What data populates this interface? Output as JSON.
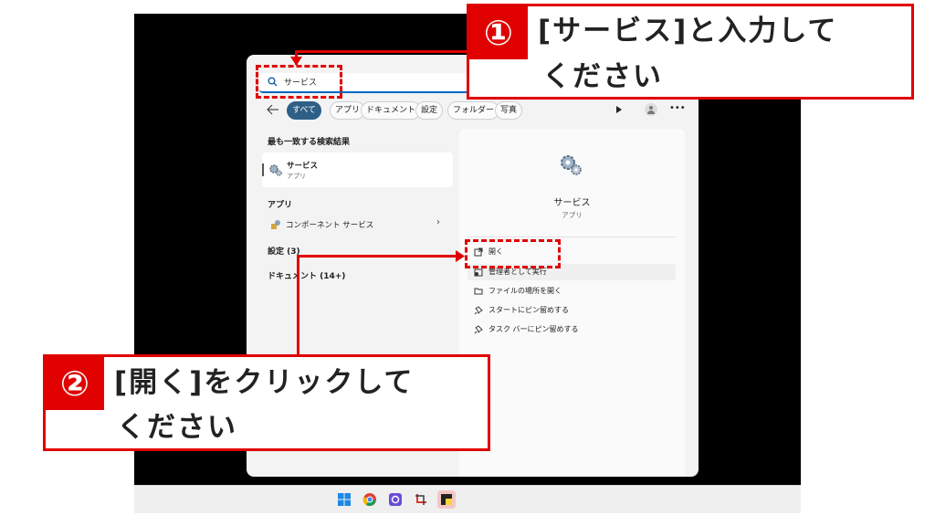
{
  "search": {
    "query": "サービス"
  },
  "tabs": [
    {
      "label": "すべて",
      "active": true
    },
    {
      "label": "アプリ"
    },
    {
      "label": "ドキュメント"
    },
    {
      "label": "設定"
    },
    {
      "label": "フォルダー"
    },
    {
      "label": "写真"
    }
  ],
  "results": {
    "best_match_heading": "最も一致する検索結果",
    "best_match": {
      "title": "サービス",
      "subtitle": "アプリ"
    },
    "apps_heading": "アプリ",
    "app_item": "コンポーネント サービス",
    "settings_heading": "設定 (3)",
    "documents_heading": "ドキュメント (14+)"
  },
  "detail": {
    "title": "サービス",
    "subtitle": "アプリ",
    "actions": [
      {
        "label": "開く",
        "icon": "open-icon"
      },
      {
        "label": "管理者として実行",
        "icon": "admin-shield-icon"
      },
      {
        "label": "ファイルの場所を開く",
        "icon": "folder-icon"
      },
      {
        "label": "スタートにピン留めする",
        "icon": "pin-icon"
      },
      {
        "label": "タスク バーにピン留めする",
        "icon": "pin-icon"
      }
    ]
  },
  "callouts": {
    "step1": {
      "number": "①",
      "line1": "[サービス]と入力して",
      "line2": "ください"
    },
    "step2": {
      "number": "②",
      "line1": "[開く]をクリックして",
      "line2": "ください"
    }
  },
  "colors": {
    "accent_red": "#e00000",
    "active_tab": "#2e5f86",
    "windows_blue": "#0067c0"
  }
}
